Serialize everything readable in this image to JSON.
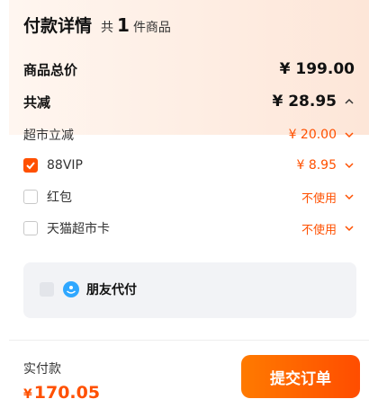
{
  "header": {
    "title": "付款详情",
    "count_prefix": "共",
    "count": "1",
    "count_suffix": "件商品"
  },
  "summary": {
    "total_label": "商品总价",
    "total_value": "¥ 199.00",
    "discount_label": "共减",
    "discount_value": "¥ 28.95"
  },
  "discounts": {
    "supermarket_label": "超市立减",
    "supermarket_value": "¥ 20.00",
    "vip_label": "88VIP",
    "vip_value": "¥ 8.95",
    "vip_checked": true,
    "redpacket_label": "红包",
    "redpacket_value": "不使用",
    "tmallcard_label": "天猫超市卡",
    "tmallcard_value": "不使用"
  },
  "proxy": {
    "label": "朋友代付"
  },
  "footer": {
    "pay_label": "实付款",
    "pay_currency": "¥",
    "pay_value": "170.05",
    "submit_label": "提交订单"
  },
  "colors": {
    "accent": "#ff5000",
    "proxy_icon": "#2fa7ff"
  }
}
